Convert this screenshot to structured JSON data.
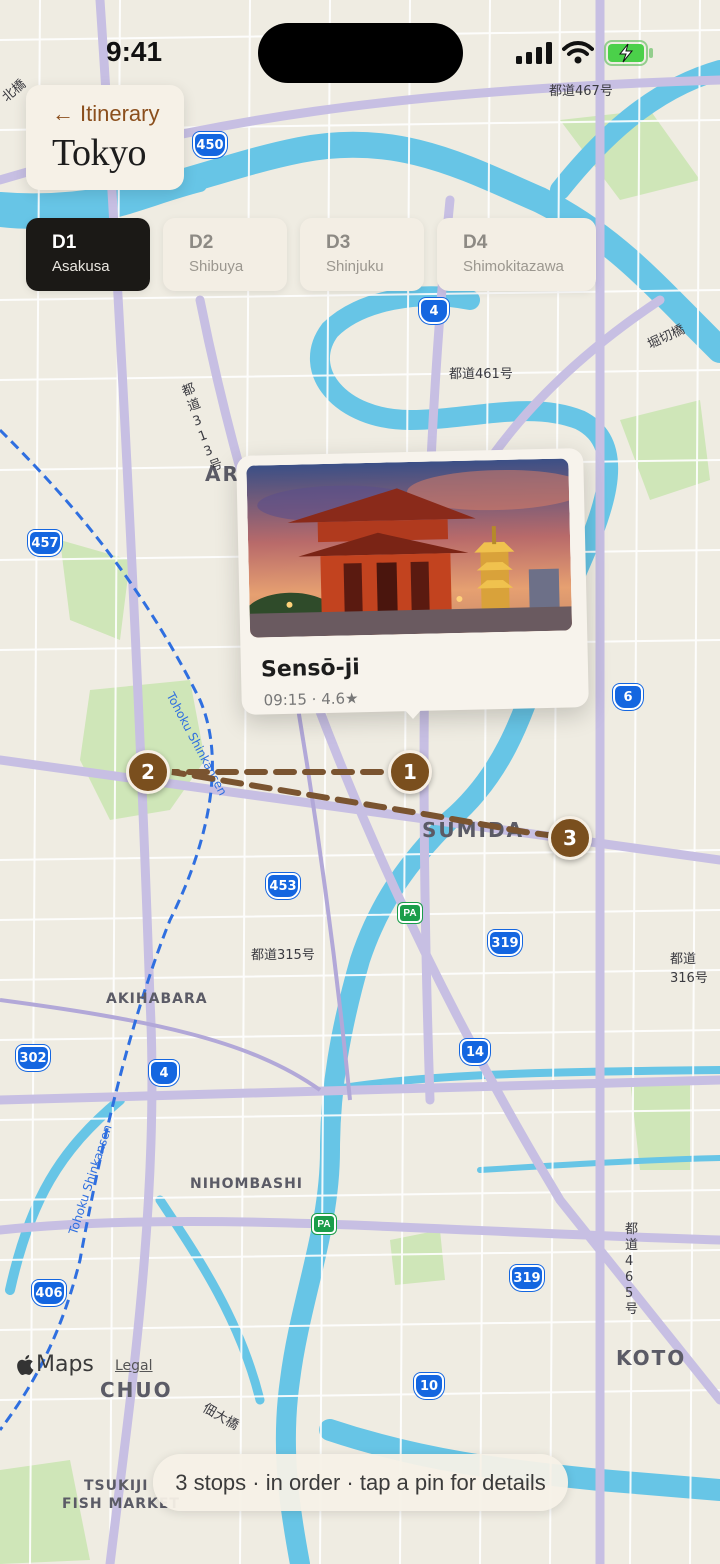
{
  "status_bar": {
    "time": "9:41"
  },
  "header": {
    "back_label": "Itinerary",
    "title": "Tokyo"
  },
  "tabs": [
    {
      "day": "D1",
      "area": "Asakusa",
      "active": true
    },
    {
      "day": "D2",
      "area": "Shibuya",
      "active": false
    },
    {
      "day": "D3",
      "area": "Shinjuku",
      "active": false
    },
    {
      "day": "D4",
      "area": "Shimokitazawa",
      "active": false
    }
  ],
  "popup": {
    "title": "Sensō-ji",
    "time": "09:15",
    "rating": "4.6★"
  },
  "pins": [
    {
      "number": "1"
    },
    {
      "number": "2"
    },
    {
      "number": "3"
    }
  ],
  "map": {
    "labels": {
      "arakawa": "ARAKAWA",
      "sumida": "SUMIDA",
      "akihabara": "AKIHABARA",
      "nihombashi": "NIHOMBASHI",
      "chuo": "CHUO",
      "koto": "KOTO",
      "tsukiji_1": "TSUKIJI",
      "tsukiji_2": "FISH MARKET",
      "road_467": "都道467号",
      "road_461": "都道461号",
      "road_315": "都道315号",
      "road_316": "都道316号",
      "road_313": "都道313号",
      "road_465": "都道465号",
      "horikiri": "堀切橋",
      "tsukudaohashi": "佃大橋",
      "kita": "北橋",
      "shinkansen_1": "Tohoku Shinkansen",
      "shinkansen_2": "Tohoku Shinkansen"
    },
    "badges": {
      "r450": "450",
      "r4a": "4",
      "r457": "457",
      "r6": "6",
      "r453": "453",
      "r319a": "319",
      "r302": "302",
      "r4b": "4",
      "r14": "14",
      "r406": "406",
      "r319b": "319",
      "r10": "10",
      "pa1": "PA",
      "pa2": "PA"
    },
    "attribution": "Maps",
    "legal": "Legal"
  },
  "footer": {
    "summary": "3 stops · in order · tap a pin for details"
  },
  "colors": {
    "pin": "#7a4f1e",
    "route_line": "#7a5430",
    "accent_brown": "#8b4f1d",
    "tab_active": "#1b1916",
    "river": "#67c5e6"
  }
}
